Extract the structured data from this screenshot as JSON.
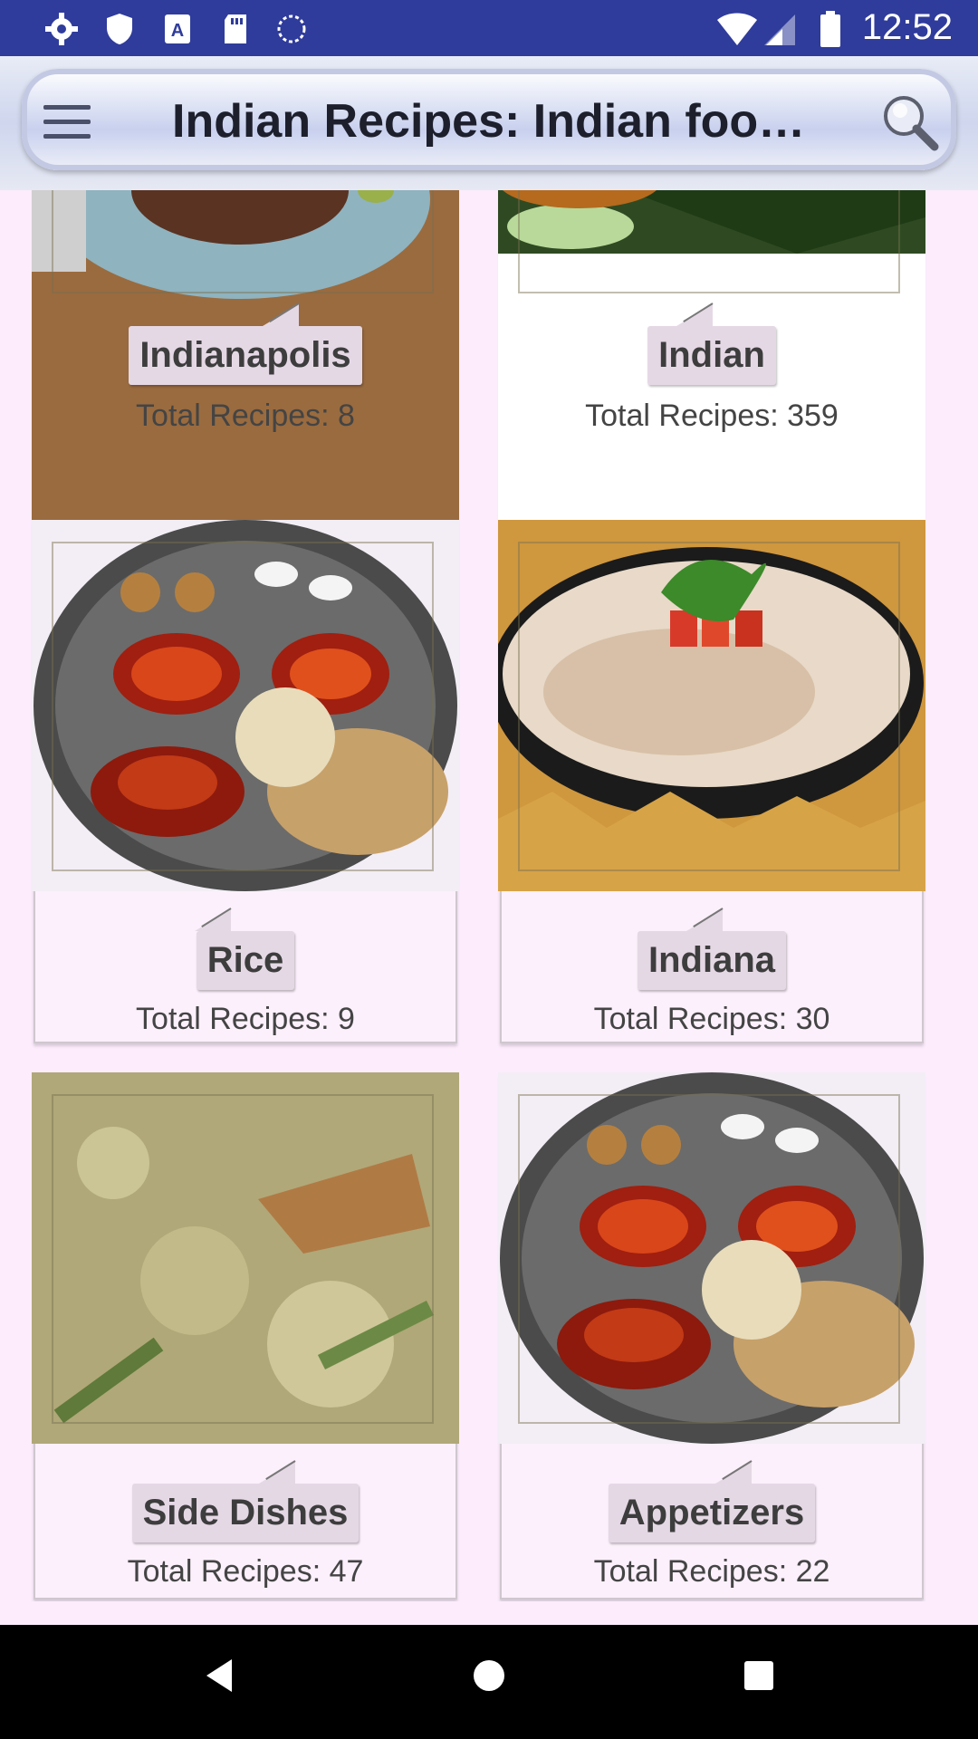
{
  "status_bar": {
    "time": "12:52",
    "icons": [
      "gear-icon",
      "shield-icon",
      "keyboard-a-icon",
      "sd-card-icon",
      "sync-icon",
      "wifi-icon",
      "signal-icon",
      "battery-icon"
    ]
  },
  "app_bar": {
    "title": "Indian Recipes: Indian food, I…",
    "menu_icon": "hamburger-menu-icon",
    "search_icon": "search-icon"
  },
  "categories": [
    {
      "name": "Indianapolis",
      "count_text": "Total Recipes: 8"
    },
    {
      "name": "Indian",
      "count_text": "Total Recipes: 359"
    },
    {
      "name": "Rice",
      "count_text": "Total Recipes: 9"
    },
    {
      "name": "Indiana",
      "count_text": "Total Recipes: 30"
    },
    {
      "name": "Side Dishes",
      "count_text": "Total Recipes: 47"
    },
    {
      "name": "Appetizers",
      "count_text": "Total Recipes: 22"
    }
  ],
  "nav_bar": {
    "icons": [
      "back-icon",
      "home-icon",
      "recents-icon"
    ]
  },
  "colors": {
    "status_bar": "#2f3c9b",
    "background": "#fcecfc",
    "label_bg": "#e5d8e5"
  }
}
